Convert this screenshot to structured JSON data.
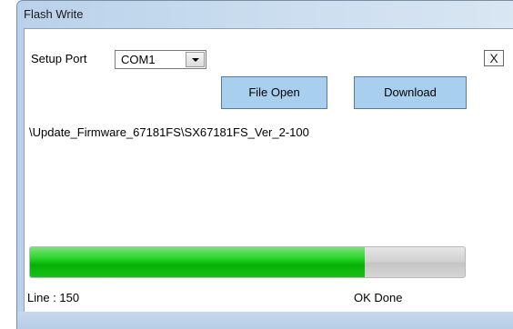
{
  "window": {
    "title": "Flash Write"
  },
  "setup": {
    "port_label": "Setup Port",
    "port_value": "COM1",
    "close_label": "X"
  },
  "buttons": {
    "file_open": "File Open",
    "download": "Download"
  },
  "file_path": "\\Update_Firmware_67181FS\\SX67181FS_Ver_2-100",
  "progress": {
    "fraction": 0.77,
    "fill_color": "#1ec81e"
  },
  "status": {
    "line": "Line : 150",
    "message": "OK Done"
  }
}
